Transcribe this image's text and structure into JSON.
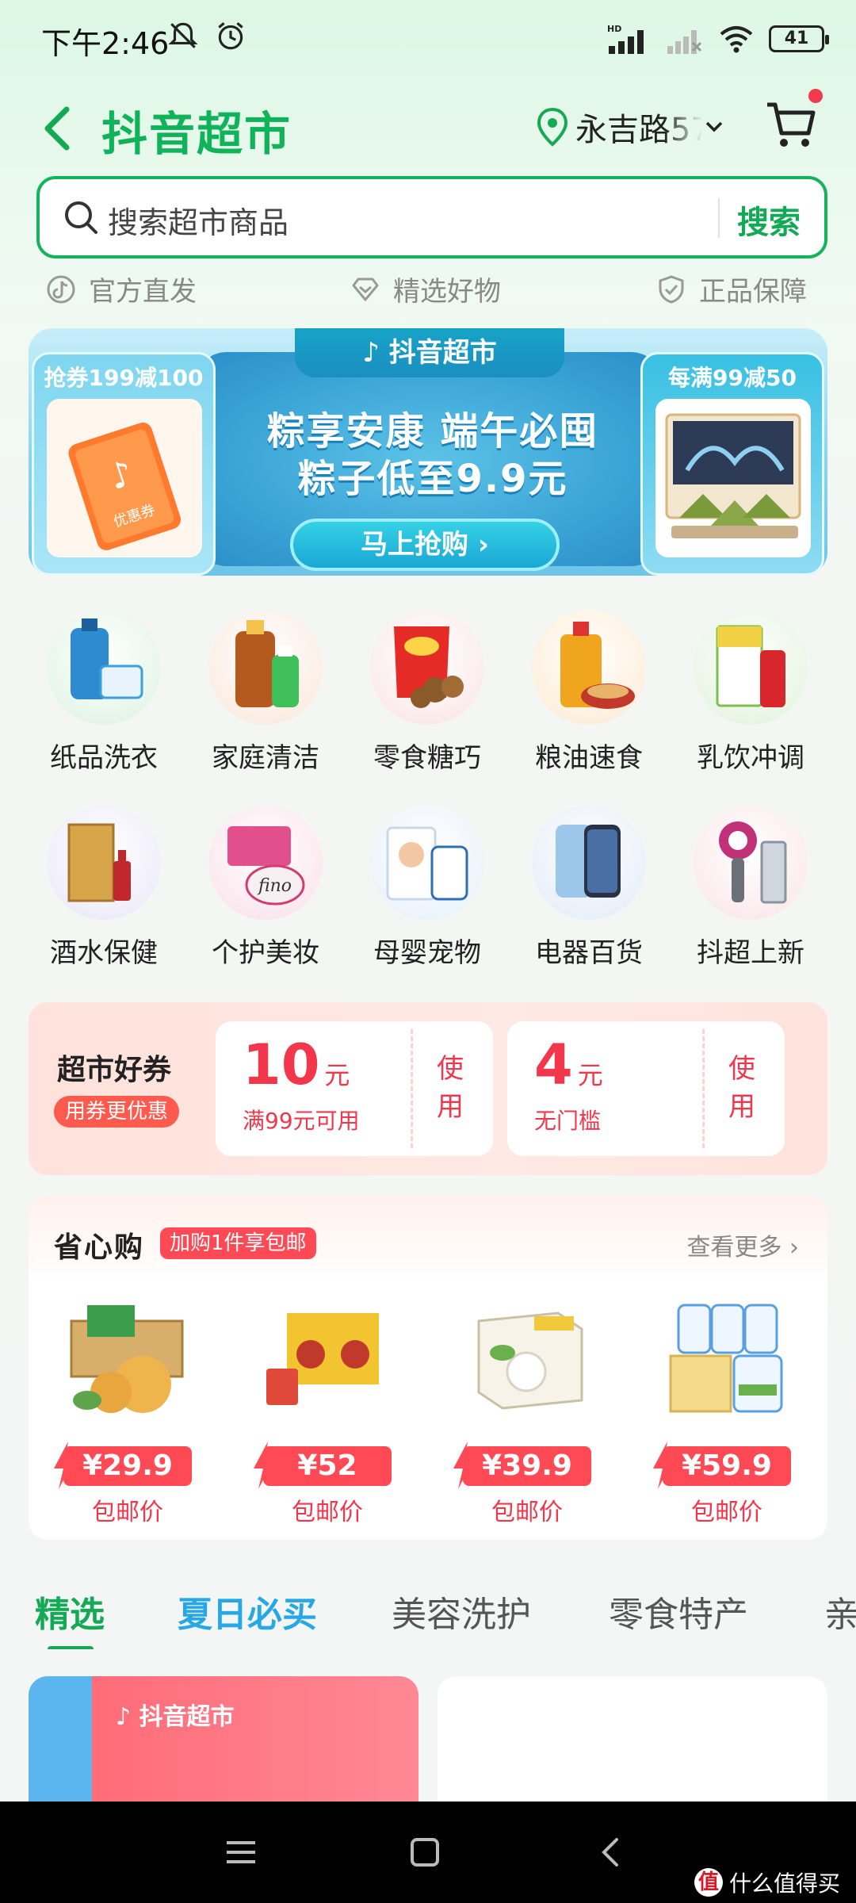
{
  "status_bar": {
    "time": "下午2:46",
    "battery": "41",
    "network_label": "HD"
  },
  "header": {
    "title": "抖音超市",
    "location": "永吉路57"
  },
  "search": {
    "placeholder": "搜索超市商品",
    "button": "搜索"
  },
  "badges": [
    "官方直发",
    "精选好物",
    "正品保障"
  ],
  "banner": {
    "tab": "抖音超市",
    "headline1": "粽享安康 端午必囤",
    "headline2": "粽子低至9.9元",
    "cta": "马上抢购 ›",
    "left_label": "抢券199减100",
    "right_label": "每满99减50",
    "left_img_text": "优惠券"
  },
  "categories": [
    {
      "label": "纸品洗衣"
    },
    {
      "label": "家庭清洁"
    },
    {
      "label": "零食糖巧"
    },
    {
      "label": "粮油速食"
    },
    {
      "label": "乳饮冲调"
    },
    {
      "label": "酒水保健"
    },
    {
      "label": "个护美妆"
    },
    {
      "label": "母婴宠物"
    },
    {
      "label": "电器百货"
    },
    {
      "label": "抖超上新"
    }
  ],
  "coupons": {
    "title": "超市好券",
    "subtitle": "用券更优惠",
    "items": [
      {
        "amount": "10",
        "unit": "元",
        "condition": "满99元可用",
        "action": "使用"
      },
      {
        "amount": "4",
        "unit": "元",
        "condition": "无门槛",
        "action": "使用"
      }
    ]
  },
  "shengxin": {
    "title": "省心购",
    "tag": "加购1件享包邮",
    "more": "查看更多 ›",
    "products": [
      {
        "price": "¥29.9",
        "note": "包邮价"
      },
      {
        "price": "¥52",
        "note": "包邮价"
      },
      {
        "price": "¥39.9",
        "note": "包邮价"
      },
      {
        "price": "¥59.9",
        "note": "包邮价"
      }
    ]
  },
  "tabs": [
    "精选",
    "夏日必买",
    "美容洗护",
    "零食特产",
    "亲"
  ],
  "feed": {
    "card1_label": "抖音超市"
  },
  "watermark": {
    "logo": "值",
    "text": "什么值得买"
  },
  "colors": {
    "brand_green": "#13a955",
    "price_red": "#f2364b",
    "accent_blue": "#26a8e6"
  }
}
